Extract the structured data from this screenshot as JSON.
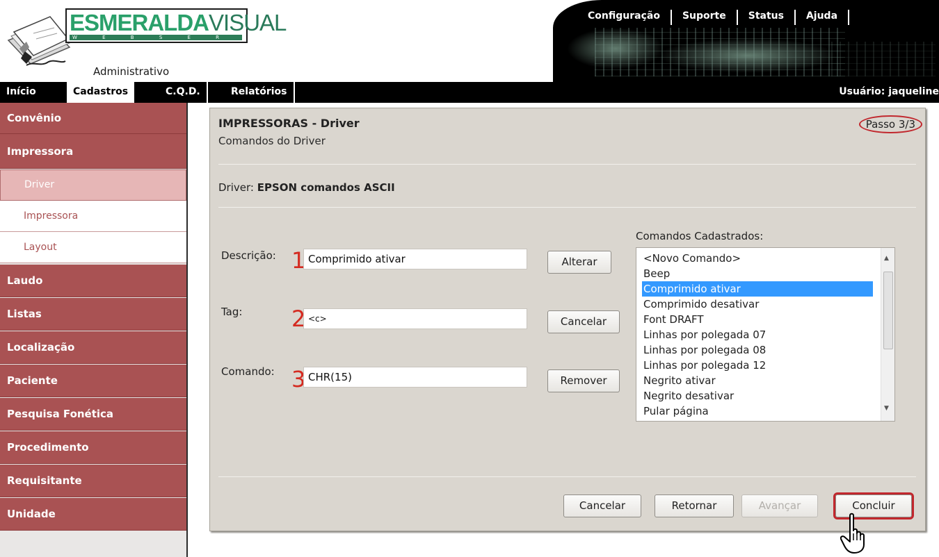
{
  "logo": {
    "brand_bold": "ESMERALDA",
    "brand_light": "VISUAL",
    "strip": "W E B S E R V I C E",
    "subtitle": "Administrativo"
  },
  "top_menu": [
    "Configuração",
    "Suporte",
    "Status",
    "Ajuda"
  ],
  "nav": {
    "items": [
      "Início",
      "Cadastros",
      "C.Q.D.",
      "Relatórios"
    ],
    "active": "Cadastros",
    "user": "Usuário: jaqueline"
  },
  "sidebar": {
    "items": [
      {
        "label": "Convênio",
        "level": "main"
      },
      {
        "label": "Impressora",
        "level": "main"
      },
      {
        "label": "Driver",
        "level": "sub",
        "active": true
      },
      {
        "label": "Impressora",
        "level": "sub"
      },
      {
        "label": "Layout",
        "level": "sub"
      },
      {
        "label": "Laudo",
        "level": "main"
      },
      {
        "label": "Listas",
        "level": "main"
      },
      {
        "label": "Localização",
        "level": "main"
      },
      {
        "label": "Paciente",
        "level": "main"
      },
      {
        "label": "Pesquisa Fonética",
        "level": "main"
      },
      {
        "label": "Procedimento",
        "level": "main"
      },
      {
        "label": "Requisitante",
        "level": "main"
      },
      {
        "label": "Unidade",
        "level": "main"
      }
    ]
  },
  "panel": {
    "title": "IMPRESSORAS - Driver",
    "subtitle": "Comandos do Driver",
    "step": "Passo 3/3",
    "driver_label": "Driver:",
    "driver_name": "EPSON comandos ASCII",
    "fields": {
      "descricao": {
        "label": "Descrição:",
        "number": "1",
        "value": "Comprimido ativar"
      },
      "tag": {
        "label": "Tag:",
        "number": "2",
        "value": "<c>"
      },
      "comando": {
        "label": "Comando:",
        "number": "3",
        "value": "CHR(15)"
      }
    },
    "side_buttons": {
      "alterar": "Alterar",
      "cancelar": "Cancelar",
      "remover": "Remover"
    },
    "list": {
      "label": "Comandos Cadastrados:",
      "items": [
        "<Novo Comando>",
        "Beep",
        "Comprimido ativar",
        "Comprimido desativar",
        "Font DRAFT",
        "Linhas por polegada 07",
        "Linhas por polegada 08",
        "Linhas por polegada 12",
        "Negrito ativar",
        "Negrito desativar",
        "Pular página"
      ],
      "selected": "Comprimido ativar"
    },
    "footer_buttons": {
      "cancelar": "Cancelar",
      "retornar": "Retornar",
      "avancar": "Avançar",
      "concluir": "Concluir"
    }
  },
  "colors": {
    "sidebar_main": "#a95253",
    "sidebar_sub_active": "#e6b6b6",
    "highlight_red": "#c1272d",
    "list_selection": "#3399ff",
    "number_red": "#d42a20",
    "logo_green": "#2aa06a"
  }
}
